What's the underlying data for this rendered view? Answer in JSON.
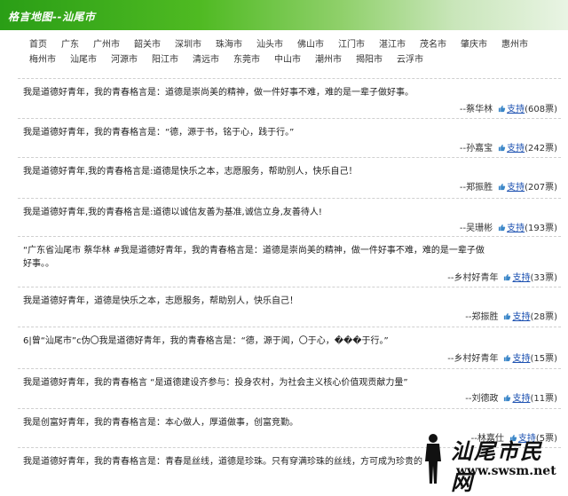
{
  "header": {
    "title": "格言地图--汕尾市"
  },
  "nav": {
    "links": [
      "首页",
      "广东",
      "广州市",
      "韶关市",
      "深圳市",
      "珠海市",
      "汕头市",
      "佛山市",
      "江门市",
      "湛江市",
      "茂名市",
      "肇庆市",
      "惠州市",
      "梅州市",
      "汕尾市",
      "河源市",
      "阳江市",
      "清远市",
      "东莞市",
      "中山市",
      "潮州市",
      "揭阳市",
      "云浮市"
    ]
  },
  "support_label": "支持",
  "entries": [
    {
      "text": "我是道德好青年，我的青春格言是：道德是崇尚美的精神，做一件好事不难，难的是一辈子做好事。",
      "author": "--蔡华林",
      "votes": "(608票)"
    },
    {
      "text": "我是道德好青年，我的青春格言是：“德，源于书，铭于心，践于行。”",
      "author": "--孙嘉宝",
      "votes": "(242票)"
    },
    {
      "text": "我是道德好青年,我的青春格言是:道德是快乐之本，志愿服务，帮助别人，快乐自己！",
      "author": "--郑振胜",
      "votes": "(207票)"
    },
    {
      "text": "我是道德好青年,我的青春格言是:道德以诚信友善为基准,诚信立身,友善待人!",
      "author": "--吴珊彬",
      "votes": "(193票)"
    },
    {
      "text": "“广东省汕尾市 蔡华林 #我是道德好青年，我的青春格言是：道德是崇尚美的精神，做一件好事不难，难的是一辈子做好事。。",
      "author": "--乡村好青年",
      "votes": "(33票)"
    },
    {
      "text": "我是道德好青年，道德是快乐之本，志愿服务，帮助别人，快乐自己！",
      "author": "--郑振胜",
      "votes": "(28票)"
    },
    {
      "text": "6|曾“汕尾市”c伪〇我是道德好青年，我的青春格言是：“德，源于闻，〇于心，���于行。”",
      "author": "--乡村好青年",
      "votes": "(15票)"
    },
    {
      "text": "我是道德好青年，我的青春格言 “是道德建设齐参与：投身农村，为社会主义核心价值观贡献力量”",
      "author": "--刘德政",
      "votes": "(11票)"
    },
    {
      "text": "我是创富好青年，我的青春格言是：本心做人，厚道做事，创富竞勤。",
      "author": "--林嘉仕",
      "votes": "(5票)"
    },
    {
      "text": "我是道德好青年，我的青春格言是：青春是丝线，道德是珍珠。只有穿满珍珠的丝线，方可成为珍贵的",
      "author": "",
      "votes": ""
    }
  ],
  "watermark": {
    "brand": "汕尾市民网",
    "url": "www.swsm.net"
  }
}
